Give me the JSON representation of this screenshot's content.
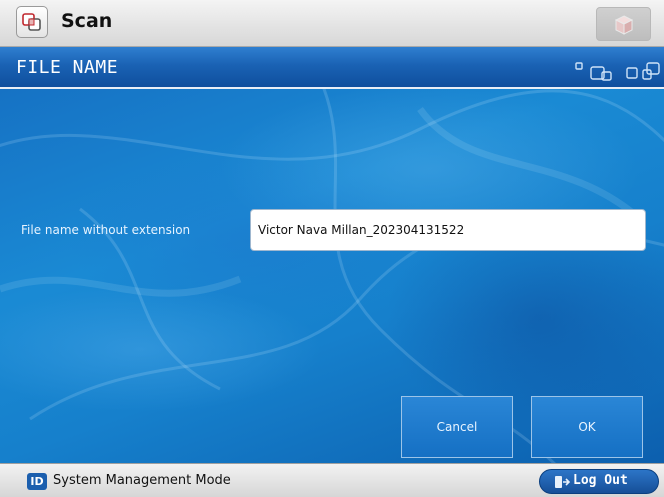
{
  "app": {
    "title": "Scan",
    "icon": "scan-app-icon",
    "top_right_icon": "cube-icon"
  },
  "header": {
    "title": "FILE NAME",
    "decoration_icon": "window-stack-icon"
  },
  "form": {
    "file_name_label": "File name without extension",
    "file_name_value": "Victor Nava Millan_202304131522"
  },
  "buttons": {
    "cancel": "Cancel",
    "ok": "OK"
  },
  "status": {
    "badge": "ID",
    "mode": "System Management Mode",
    "logout": "Log Out",
    "logout_icon": "logout-icon"
  },
  "colors": {
    "header_blue": "#1a62b4",
    "content_blue": "#1a8ad4",
    "button_border": "#9cc4e8"
  }
}
